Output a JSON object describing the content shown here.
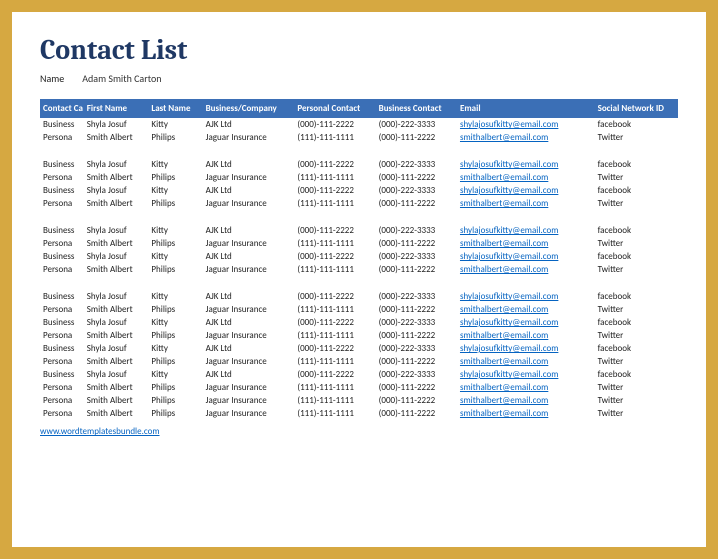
{
  "title": "Contact List",
  "name_label": "Name",
  "name_value": "Adam Smith Carton",
  "headers": [
    "Contact Ca",
    "First Name",
    "Last Name",
    "Business/Company",
    "Personal Contact",
    "Business Contact",
    "Email",
    "Social Network ID"
  ],
  "groups": [
    [
      {
        "cat": "Business",
        "first": "Shyla Josuf",
        "last": "Kitty",
        "company": "AJK Ltd",
        "personal": "(000)-111-2222",
        "business": "(000)-222-3333",
        "email": "shylajosufkitty@email.com",
        "social": "facebook"
      },
      {
        "cat": "Persona",
        "first": "Smith Albert",
        "last": "Philips",
        "company": "Jaguar Insurance",
        "personal": "(111)-111-1111",
        "business": "(000)-111-2222",
        "email": "smithalbert@email.com",
        "social": "Twitter"
      }
    ],
    [
      {
        "cat": "Business",
        "first": "Shyla Josuf",
        "last": "Kitty",
        "company": "AJK Ltd",
        "personal": "(000)-111-2222",
        "business": "(000)-222-3333",
        "email": "shylajosufkitty@email.com",
        "social": "facebook"
      },
      {
        "cat": "Persona",
        "first": "Smith Albert",
        "last": "Philips",
        "company": "Jaguar Insurance",
        "personal": "(111)-111-1111",
        "business": "(000)-111-2222",
        "email": "smithalbert@email.com",
        "social": "Twitter"
      },
      {
        "cat": "Business",
        "first": "Shyla Josuf",
        "last": "Kitty",
        "company": "AJK Ltd",
        "personal": "(000)-111-2222",
        "business": "(000)-222-3333",
        "email": "shylajosufkitty@email.com",
        "social": "facebook"
      },
      {
        "cat": "Persona",
        "first": "Smith Albert",
        "last": "Philips",
        "company": "Jaguar Insurance",
        "personal": "(111)-111-1111",
        "business": "(000)-111-2222",
        "email": "smithalbert@email.com",
        "social": "Twitter"
      }
    ],
    [
      {
        "cat": "Business",
        "first": "Shyla Josuf",
        "last": "Kitty",
        "company": "AJK Ltd",
        "personal": "(000)-111-2222",
        "business": "(000)-222-3333",
        "email": "shylajosufkitty@email.com",
        "social": "facebook"
      },
      {
        "cat": "Persona",
        "first": "Smith Albert",
        "last": "Philips",
        "company": "Jaguar Insurance",
        "personal": "(111)-111-1111",
        "business": "(000)-111-2222",
        "email": "smithalbert@email.com",
        "social": "Twitter"
      },
      {
        "cat": "Business",
        "first": "Shyla Josuf",
        "last": "Kitty",
        "company": "AJK Ltd",
        "personal": "(000)-111-2222",
        "business": "(000)-222-3333",
        "email": "shylajosufkitty@email.com",
        "social": "facebook"
      },
      {
        "cat": "Persona",
        "first": "Smith Albert",
        "last": "Philips",
        "company": "Jaguar Insurance",
        "personal": "(111)-111-1111",
        "business": "(000)-111-2222",
        "email": "smithalbert@email.com",
        "social": "Twitter"
      }
    ],
    [
      {
        "cat": "Business",
        "first": "Shyla Josuf",
        "last": "Kitty",
        "company": "AJK Ltd",
        "personal": "(000)-111-2222",
        "business": "(000)-222-3333",
        "email": "shylajosufkitty@email.com",
        "social": "facebook"
      },
      {
        "cat": "Persona",
        "first": "Smith Albert",
        "last": "Philips",
        "company": "Jaguar Insurance",
        "personal": "(111)-111-1111",
        "business": "(000)-111-2222",
        "email": "smithalbert@email.com",
        "social": "Twitter"
      },
      {
        "cat": "Business",
        "first": "Shyla Josuf",
        "last": "Kitty",
        "company": "AJK Ltd",
        "personal": "(000)-111-2222",
        "business": "(000)-222-3333",
        "email": "shylajosufkitty@email.com",
        "social": "facebook"
      },
      {
        "cat": "Persona",
        "first": "Smith Albert",
        "last": "Philips",
        "company": "Jaguar Insurance",
        "personal": "(111)-111-1111",
        "business": "(000)-111-2222",
        "email": "smithalbert@email.com",
        "social": "Twitter"
      },
      {
        "cat": "Business",
        "first": "Shyla Josuf",
        "last": "Kitty",
        "company": "AJK Ltd",
        "personal": "(000)-111-2222",
        "business": "(000)-222-3333",
        "email": "shylajosufkitty@email.com",
        "social": "facebook"
      },
      {
        "cat": "Persona",
        "first": "Smith Albert",
        "last": "Philips",
        "company": "Jaguar Insurance",
        "personal": "(111)-111-1111",
        "business": "(000)-111-2222",
        "email": "smithalbert@email.com",
        "social": "Twitter"
      },
      {
        "cat": "Business",
        "first": "Shyla Josuf",
        "last": "Kitty",
        "company": "AJK Ltd",
        "personal": "(000)-111-2222",
        "business": "(000)-222-3333",
        "email": "shylajosufkitty@email.com",
        "social": "facebook"
      },
      {
        "cat": "Persona",
        "first": "Smith Albert",
        "last": "Philips",
        "company": "Jaguar Insurance",
        "personal": "(111)-111-1111",
        "business": "(000)-111-2222",
        "email": "smithalbert@email.com",
        "social": "Twitter"
      },
      {
        "cat": "Persona",
        "first": "Smith Albert",
        "last": "Philips",
        "company": "Jaguar Insurance",
        "personal": "(111)-111-1111",
        "business": "(000)-111-2222",
        "email": "smithalbert@email.com",
        "social": "Twitter"
      },
      {
        "cat": "Persona",
        "first": "Smith Albert",
        "last": "Philips",
        "company": "Jaguar Insurance",
        "personal": "(111)-111-1111",
        "business": "(000)-111-2222",
        "email": "smithalbert@email.com",
        "social": "Twitter"
      }
    ]
  ],
  "footer_link": "www.wordtemplatesbundle.com"
}
